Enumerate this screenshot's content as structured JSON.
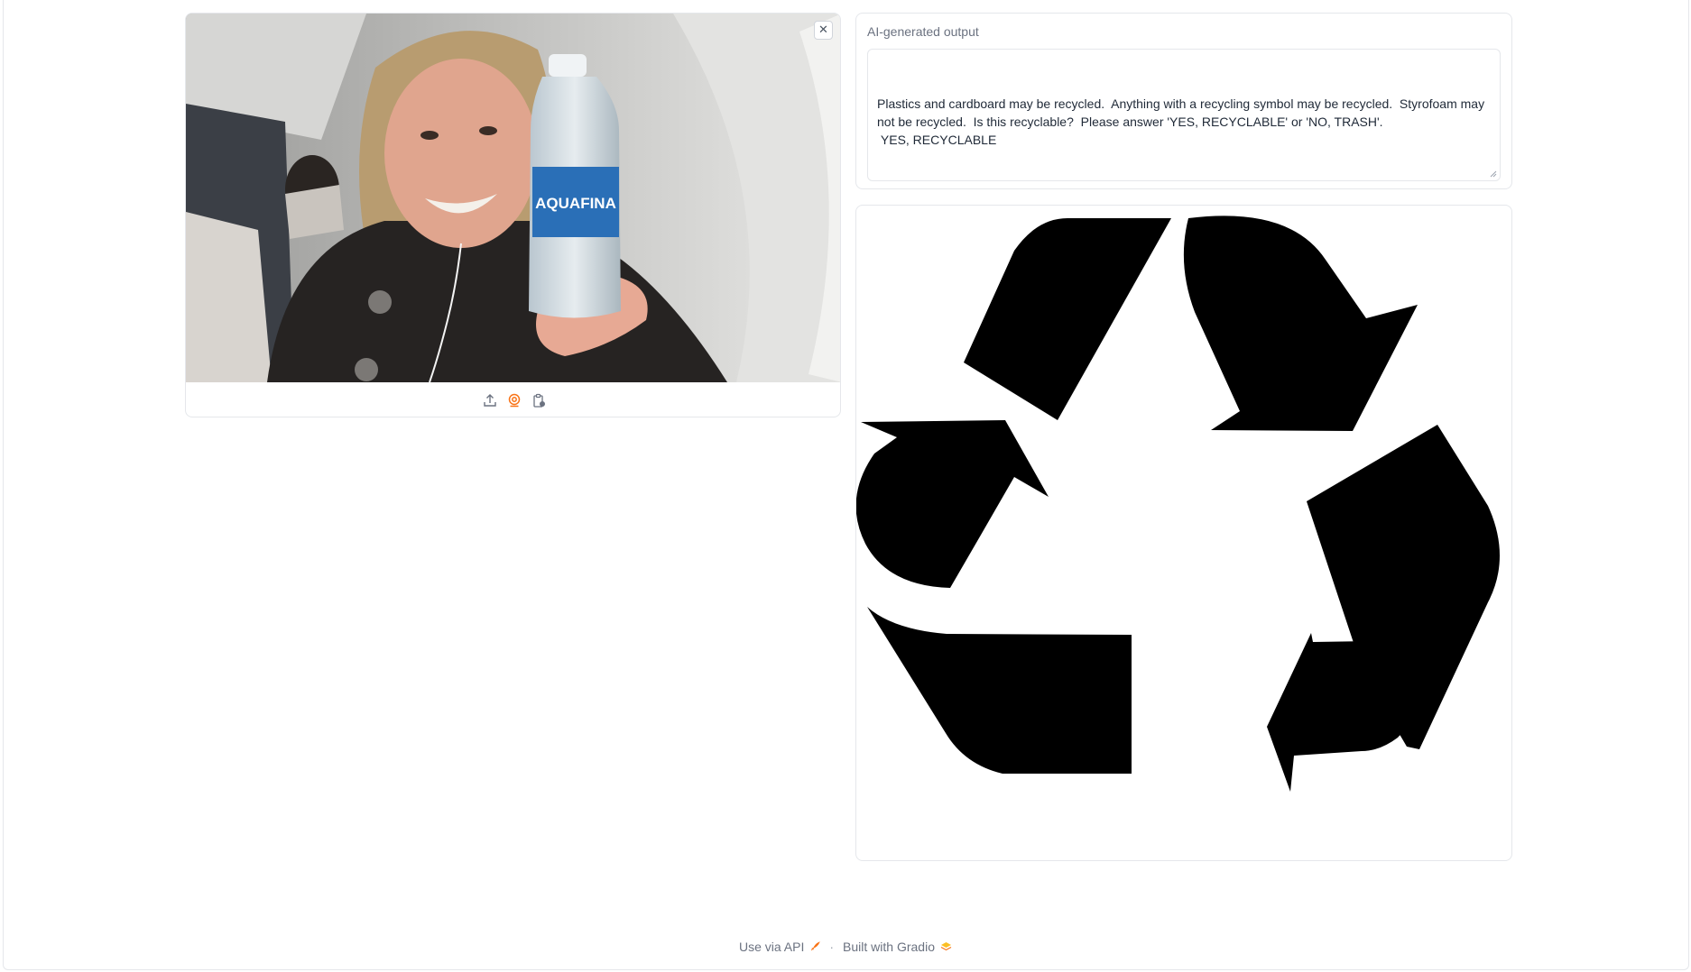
{
  "image_input": {
    "clear_icon": "close-icon",
    "sources": [
      {
        "name": "upload-icon"
      },
      {
        "name": "webcam-icon",
        "active": true
      },
      {
        "name": "clipboard-icon"
      }
    ],
    "bottle_label": "AQUAFINA",
    "accent": "#f97316"
  },
  "output": {
    "label": "AI-generated output",
    "value": "\nPlastics and cardboard may be recycled.  Anything with a recycling symbol may be recycled.  Styrofoam may not be recycled.  Is this recyclable?  Please answer 'YES, RECYCLABLE' or 'NO, TRASH'.\n YES, RECYCLABLE"
  },
  "result_image": {
    "icon": "recycle-symbol-icon",
    "color": "#000000"
  },
  "footer": {
    "api_label": "Use via API",
    "separator": "·",
    "built_label": "Built with Gradio"
  }
}
